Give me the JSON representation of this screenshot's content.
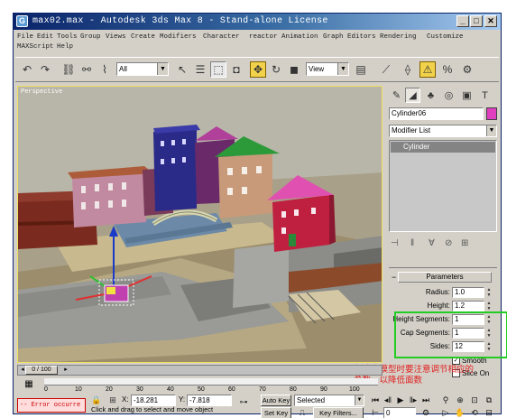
{
  "window": {
    "title": "max02.max - Autodesk 3ds Max 8 - Stand-alone License",
    "icon": "3dsmax-logo-icon"
  },
  "menu": {
    "items": [
      "File",
      "Edit",
      "Tools",
      "Group",
      "Views",
      "Create",
      "Modifiers",
      "Character",
      "reactor",
      "Animation",
      "Graph Editors",
      "Rendering",
      "Customize",
      "MAXScript",
      "Help"
    ]
  },
  "toolbar": {
    "selection_filter": "All",
    "reference_coord": "View"
  },
  "viewport": {
    "label": "Perspective"
  },
  "command_panel": {
    "object_name": "Cylinder06",
    "object_color": "#e040c0",
    "modifier_list": "Modifier List",
    "stack_items": [
      "Cylinder"
    ],
    "rollout_title": "Parameters",
    "params": [
      {
        "label": "Radius:",
        "value": "1.0"
      },
      {
        "label": "Height:",
        "value": "1.2"
      },
      {
        "label": "Height Segments:",
        "value": "1"
      },
      {
        "label": "Cap Segments:",
        "value": "1"
      },
      {
        "label": "Sides:",
        "value": "12"
      }
    ],
    "smooth_label": "Smooth",
    "smooth_checked": "✓",
    "slice_label": "Slice On"
  },
  "annotation": {
    "text": "在建立模型时要注意调节相应的参数，以降低面数"
  },
  "timeline": {
    "frame_indicator": "0 / 100",
    "ticks": [
      "0",
      "10",
      "20",
      "30",
      "40",
      "50",
      "60",
      "70",
      "80",
      "90",
      "100"
    ]
  },
  "status": {
    "error_text": "-- Error occurre",
    "x_label": "X:",
    "x_value": "-18.281",
    "y_label": "Y:",
    "y_value": "-7.818",
    "prompt": "Click and drag to select and move object",
    "auto_key": "Auto Key",
    "set_key": "Set Key",
    "selected_dropdown": "Selected",
    "key_filters": "Key Filters...",
    "current_frame": "0"
  },
  "colors": {
    "highlight_box": "#22cc22",
    "annotation": "#e02020",
    "active_tool": "#f2d24b"
  }
}
